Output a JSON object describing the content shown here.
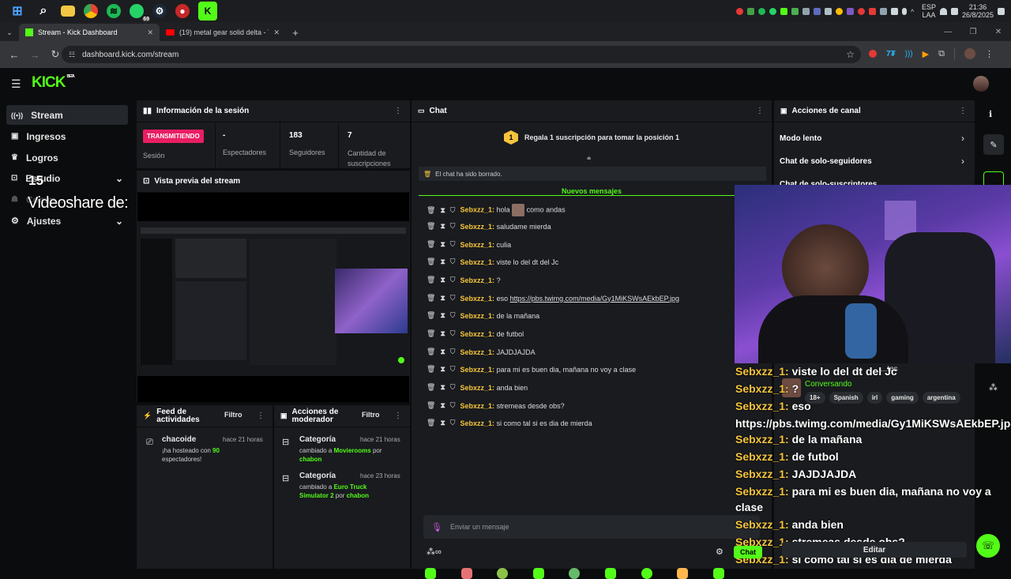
{
  "taskbar": {
    "locale_top": "ESP",
    "locale_bottom": "LAA",
    "time": "21:36",
    "date": "26/8/2025",
    "whatsapp_badge": "69"
  },
  "browser": {
    "tabs": [
      {
        "title": "Stream - Kick Dashboard"
      },
      {
        "title": "(19) metal gear solid delta - Yo"
      }
    ],
    "url": "dashboard.kick.com/stream"
  },
  "app": {
    "logo": "KICK",
    "logo_badge": "BETA",
    "sidebar": [
      {
        "label": "Stream",
        "icon": "broadcast-icon"
      },
      {
        "label": "Ingresos",
        "icon": "dollar-icon"
      },
      {
        "label": "Logros",
        "icon": "trophy-icon"
      },
      {
        "label": "Estudio",
        "icon": "studio-icon"
      },
      {
        "label": "Ajustes",
        "icon": "gear-icon"
      }
    ],
    "sidebar_faint_item": "Comm...",
    "overlay_videoshare": "Videoshare de:",
    "overlay_number": "15",
    "session": {
      "title": "Información de la sesión",
      "status_badge": "TRANSMITIENDO",
      "status_label": "Sesión",
      "viewers_value": "-",
      "viewers_label": "Espectadores",
      "followers_value": "183",
      "followers_label": "Seguidores",
      "subs_value": "7",
      "subs_label": "Cantidad de suscripciones"
    },
    "preview": {
      "title": "Vista previa del stream"
    },
    "activity": {
      "title": "Feed de actividades",
      "filter": "Filtro",
      "items": [
        {
          "user": "chacoide",
          "time": "hace 21 horas",
          "text_before": "¡ha hosteado con ",
          "highlight": "90",
          "text_after": " espectadores!"
        }
      ]
    },
    "mod_actions": {
      "title": "Acciones de moderador",
      "filter": "Filtro",
      "items": [
        {
          "label": "Categoría",
          "time": "hace 21 horas",
          "text1": "cambiado a ",
          "category": "Movierooms",
          "text2": " por ",
          "user": "chabon"
        },
        {
          "label": "Categoría",
          "time": "hace 23 horas",
          "text1": "cambiado a ",
          "category": "Euro Truck Simulator 2",
          "text2": " por ",
          "user": "chabon"
        }
      ]
    },
    "chat": {
      "title": "Chat",
      "sub_banner_number": "1",
      "sub_banner": "Regala 1 suscripción para tomar la posición 1",
      "cleared_notice": "El chat ha sido borrado.",
      "new_messages": "Nuevos mensajes",
      "messages": [
        {
          "user": "Sebxzz_1:",
          "text": "hola",
          "text2": "como andas"
        },
        {
          "user": "Sebxzz_1:",
          "text": "saludame mierda"
        },
        {
          "user": "Sebxzz_1:",
          "text": "culia"
        },
        {
          "user": "Sebxzz_1:",
          "text": "viste lo del dt del Jc"
        },
        {
          "user": "Sebxzz_1:",
          "text": "?"
        },
        {
          "user": "Sebxzz_1:",
          "text": "eso",
          "link": "https://pbs.twimg.com/media/Gy1MiKSWsAEkbEP.jpg"
        },
        {
          "user": "Sebxzz_1:",
          "text": "de la mañana"
        },
        {
          "user": "Sebxzz_1:",
          "text": "de futbol"
        },
        {
          "user": "Sebxzz_1:",
          "text": "JAJDJAJDA"
        },
        {
          "user": "Sebxzz_1:",
          "text": "para mi es buen dia, mañana no voy a clase"
        },
        {
          "user": "Sebxzz_1:",
          "text": "anda bien"
        },
        {
          "user": "Sebxzz_1:",
          "text": "stremeas desde obs?"
        },
        {
          "user": "Sebxzz_1:",
          "text": "si como tal si es dia de mierda"
        }
      ],
      "input_placeholder": "Enviar un mensaje",
      "chat_button": "Chat"
    },
    "channel_actions": {
      "title": "Acciones de canal",
      "items": [
        "Modo lento",
        "Chat de solo-seguidores",
        "Chat de solo-suscriptores"
      ],
      "partial_text": "...tes",
      "status": "Conversando",
      "tags": [
        "18+",
        "Spanish",
        "irl",
        "gaming",
        "argentina"
      ],
      "edit_button": "Editar"
    },
    "overlay_chat": [
      {
        "user": "Sebxzz_1:",
        "text": "viste lo del dt del Jc"
      },
      {
        "user": "Sebxzz_1:",
        "text": "?"
      },
      {
        "user": "Sebxzz_1:",
        "text": "eso"
      },
      {
        "user": "",
        "text": "https://pbs.twimg.com/media/Gy1MiKSWsAEkbEP.jpg"
      },
      {
        "user": "Sebxzz_1:",
        "text": "de la mañana"
      },
      {
        "user": "Sebxzz_1:",
        "text": "de futbol"
      },
      {
        "user": "Sebxzz_1:",
        "text": "JAJDJAJDA"
      },
      {
        "user": "Sebxzz_1:",
        "text": "para mi es buen dia, mañana no voy a"
      },
      {
        "user": "",
        "text": "clase"
      },
      {
        "user": "Sebxzz_1:",
        "text": "anda bien"
      },
      {
        "user": "Sebxzz_1:",
        "text": "stremeas desde obs?"
      },
      {
        "user": "Sebxzz_1:",
        "text": "si como tal si es dia de mierda"
      }
    ]
  },
  "colors": {
    "accent": "#53fc18",
    "username": "#f6c43b",
    "live": "#e91e63"
  }
}
